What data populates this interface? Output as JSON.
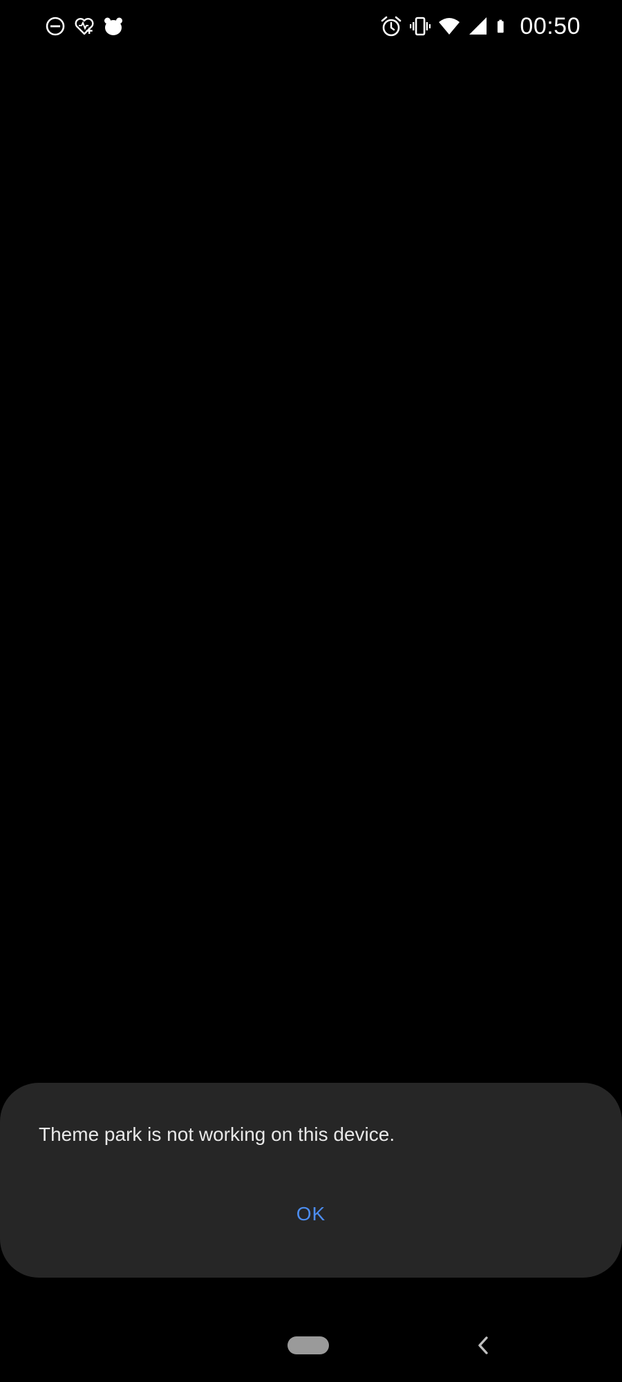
{
  "status_bar": {
    "time": "00:50",
    "left_icons": [
      "do-not-disturb-icon",
      "health-heart-icon",
      "bear-icon"
    ],
    "right_icons": [
      "alarm-icon",
      "vibrate-icon",
      "wifi-icon",
      "signal-icon",
      "battery-icon"
    ]
  },
  "dialog": {
    "message": "Theme park is not working on this device.",
    "ok_label": "OK"
  },
  "navigation": {
    "icons": [
      "home-pill-icon",
      "back-icon"
    ]
  },
  "colors": {
    "background": "#000000",
    "dialog_background": "#262626",
    "accent": "#4c8df0",
    "message_text": "#e8e8e8"
  }
}
